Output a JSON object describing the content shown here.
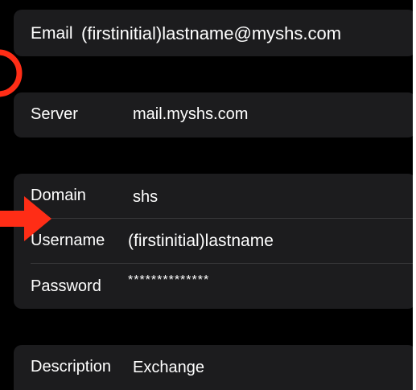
{
  "account": {
    "email": {
      "label": "Email",
      "value": "(firstinitial)lastname@myshs.com"
    },
    "server": {
      "label": "Server",
      "value": "mail.myshs.com"
    },
    "domain": {
      "label": "Domain",
      "value": "shs"
    },
    "username": {
      "label": "Username",
      "value": "(firstinitial)lastname"
    },
    "password": {
      "label": "Password",
      "value": "**************"
    },
    "description": {
      "label": "Description",
      "value": "Exchange"
    }
  },
  "annotations": {
    "color": "#ff2d16",
    "shapes": [
      "circle-outline",
      "arrow-right"
    ]
  }
}
